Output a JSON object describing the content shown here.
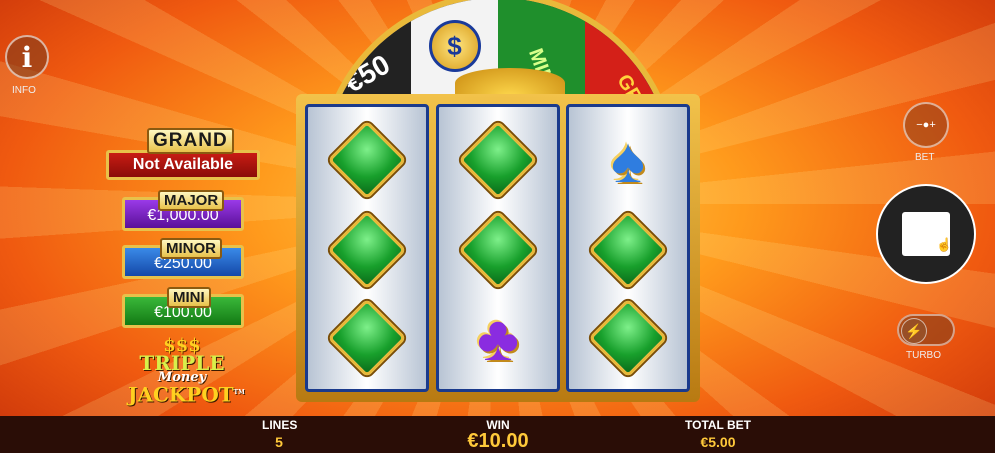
{
  "info": {
    "label": "INFO",
    "icon": "info-icon"
  },
  "wheel": {
    "segments": [
      "€50",
      "$",
      "MINI",
      "GR"
    ]
  },
  "jackpots": {
    "grand": {
      "label": "GRAND",
      "value": "Not Available"
    },
    "major": {
      "label": "MAJOR",
      "value": "€1,000.00"
    },
    "minor": {
      "label": "MINOR",
      "value": "€250.00"
    },
    "mini": {
      "label": "MINI",
      "value": "€100.00"
    }
  },
  "logo": {
    "dollars": "$$$",
    "line1": "TRIPLE",
    "line2": "Money",
    "line3": "JACKPOT",
    "tm": "TM"
  },
  "reels": [
    [
      "diamond",
      "diamond",
      "diamond"
    ],
    [
      "diamond",
      "diamond",
      "club"
    ],
    [
      "spade",
      "diamond",
      "diamond"
    ]
  ],
  "controls": {
    "bet_label": "BET",
    "turbo_label": "TURBO"
  },
  "bottom": {
    "lines_label": "LINES",
    "lines_value": "5",
    "win_label": "WIN",
    "win_value": "€10.00",
    "total_bet_label": "TOTAL BET",
    "total_bet_value": "€5.00"
  }
}
